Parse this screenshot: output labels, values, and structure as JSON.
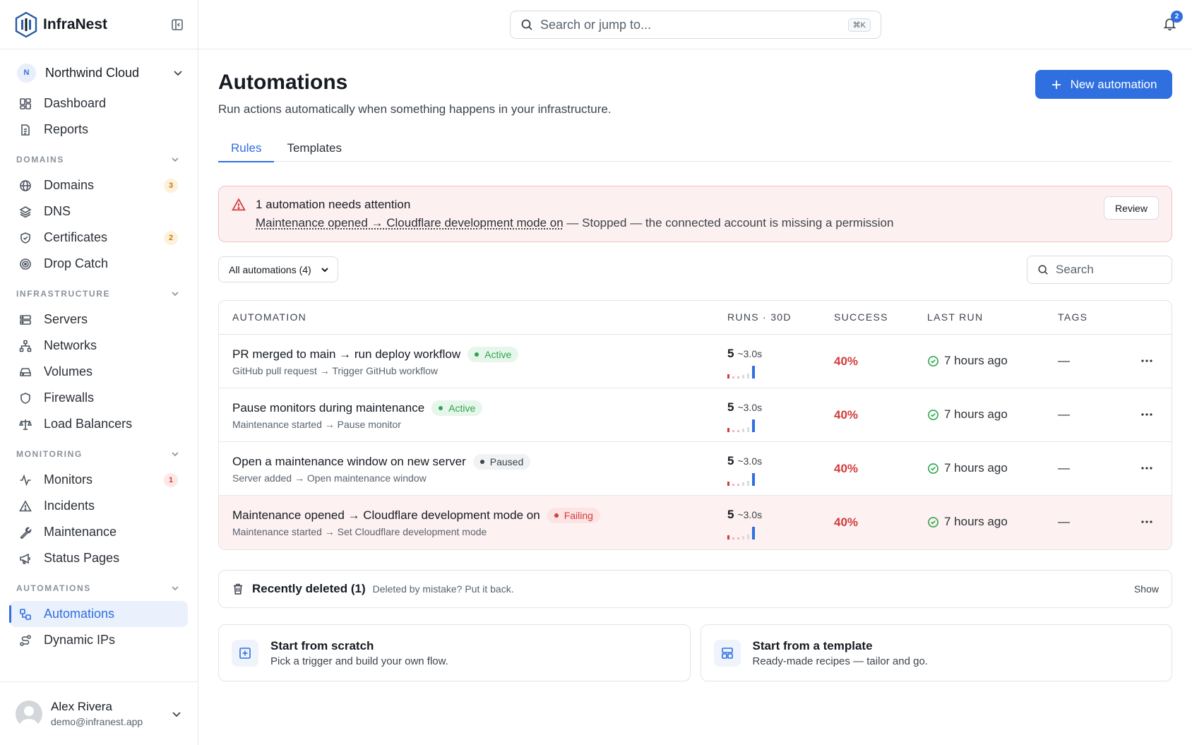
{
  "brand": {
    "name": "InfraNest"
  },
  "org": {
    "initial": "N",
    "name": "Northwind Cloud"
  },
  "nav": {
    "top": [
      {
        "label": "Dashboard",
        "icon": "dashboard-icon"
      },
      {
        "label": "Reports",
        "icon": "reports-icon"
      }
    ],
    "sections": [
      {
        "title": "DOMAINS",
        "items": [
          {
            "label": "Domains",
            "icon": "globe-icon",
            "count": "3",
            "count_color": "amber"
          },
          {
            "label": "DNS",
            "icon": "layers-icon"
          },
          {
            "label": "Certificates",
            "icon": "shield-check-icon",
            "count": "2",
            "count_color": "amber"
          },
          {
            "label": "Drop Catch",
            "icon": "target-icon"
          }
        ]
      },
      {
        "title": "INFRASTRUCTURE",
        "items": [
          {
            "label": "Servers",
            "icon": "server-icon"
          },
          {
            "label": "Networks",
            "icon": "network-icon"
          },
          {
            "label": "Volumes",
            "icon": "hard-drive-icon"
          },
          {
            "label": "Firewalls",
            "icon": "shield-icon"
          },
          {
            "label": "Load Balancers",
            "icon": "scale-icon"
          }
        ]
      },
      {
        "title": "MONITORING",
        "items": [
          {
            "label": "Monitors",
            "icon": "activity-icon",
            "count": "1",
            "count_color": "red"
          },
          {
            "label": "Incidents",
            "icon": "alert-triangle-icon"
          },
          {
            "label": "Maintenance",
            "icon": "wrench-icon"
          },
          {
            "label": "Status Pages",
            "icon": "megaphone-icon"
          }
        ]
      },
      {
        "title": "AUTOMATIONS",
        "items": [
          {
            "label": "Automations",
            "icon": "workflow-icon",
            "active": true
          },
          {
            "label": "Dynamic IPs",
            "icon": "route-icon"
          }
        ]
      }
    ]
  },
  "user": {
    "name": "Alex Rivera",
    "email": "demo@infranest.app"
  },
  "topbar": {
    "search_placeholder": "Search or jump to...",
    "shortcut": "⌘K",
    "notifications": "2"
  },
  "page": {
    "title": "Automations",
    "subtitle": "Run actions automatically when something happens in your infrastructure.",
    "new_button": "New automation",
    "tabs": [
      {
        "label": "Rules",
        "active": true
      },
      {
        "label": "Templates",
        "active": false
      }
    ]
  },
  "alert": {
    "title": "1 automation needs attention",
    "link": "Maintenance opened → Cloudflare development mode on",
    "rest": " — Stopped — the connected account is missing a permission",
    "button": "Review"
  },
  "filter": {
    "selected": "All automations (4)",
    "search_placeholder": "Search"
  },
  "table": {
    "headers": {
      "automation": "AUTOMATION",
      "runs": "RUNS · 30D",
      "success": "SUCCESS",
      "last_run": "LAST RUN",
      "tags": "TAGS"
    },
    "rows": [
      {
        "name": "PR merged to main → run deploy workflow",
        "status": "Active",
        "status_kind": "active",
        "trigger": "GitHub pull request → Trigger GitHub workflow",
        "runs": "5",
        "duration": "~3.0s",
        "success": "40%",
        "last_run": "7 hours ago",
        "tags": "—"
      },
      {
        "name": "Pause monitors during maintenance",
        "status": "Active",
        "status_kind": "active",
        "trigger": "Maintenance started → Pause monitor",
        "runs": "5",
        "duration": "~3.0s",
        "success": "40%",
        "last_run": "7 hours ago",
        "tags": "—"
      },
      {
        "name": "Open a maintenance window on new server",
        "status": "Paused",
        "status_kind": "paused",
        "trigger": "Server added → Open maintenance window",
        "runs": "5",
        "duration": "~3.0s",
        "success": "40%",
        "last_run": "7 hours ago",
        "tags": "—"
      },
      {
        "name": "Maintenance opened → Cloudflare development mode on",
        "status": "Failing",
        "status_kind": "failing",
        "trigger": "Maintenance started → Set Cloudflare development mode",
        "runs": "5",
        "duration": "~3.0s",
        "success": "40%",
        "last_run": "7 hours ago",
        "tags": "—"
      }
    ]
  },
  "deleted": {
    "title": "Recently deleted (1)",
    "hint": "Deleted by mistake? Put it back.",
    "action": "Show"
  },
  "cards": [
    {
      "title": "Start from scratch",
      "desc": "Pick a trigger and build your own flow.",
      "icon": "plus-square-icon"
    },
    {
      "title": "Start from a template",
      "desc": "Ready-made recipes — tailor and go.",
      "icon": "layout-template-icon"
    }
  ],
  "colors": {
    "accent": "#2f6fe0",
    "success": "#2da44e",
    "danger": "#d23c3c",
    "warning": "#c27c0e"
  }
}
